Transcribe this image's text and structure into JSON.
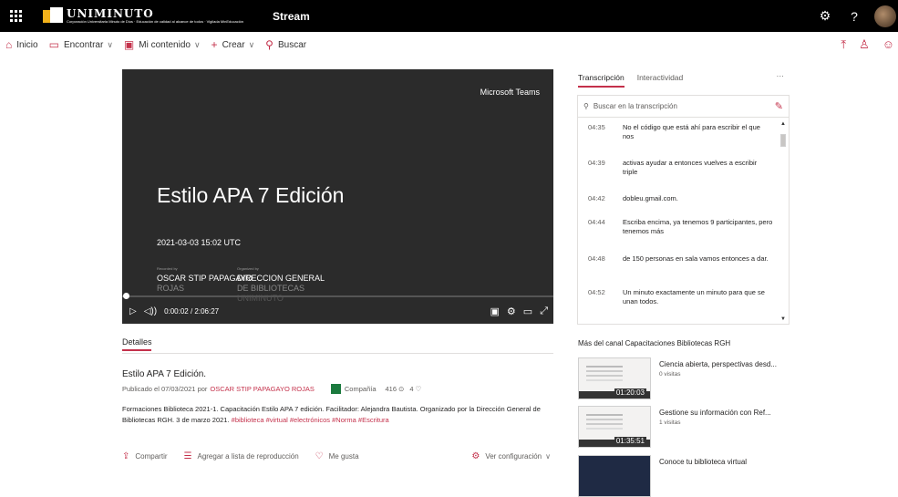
{
  "app": {
    "logo_name": "UNIMINUTO",
    "logo_sub": "Corporación Universitaria Minuto de Dios · Educación de calidad al alcance de todos · Vigilada MinEducación",
    "title": "Stream"
  },
  "nav": {
    "items": [
      {
        "label": "Inicio",
        "icon": "home-icon"
      },
      {
        "label": "Encontrar",
        "icon": "find-icon",
        "chevron": true
      },
      {
        "label": "Mi contenido",
        "icon": "content-icon",
        "chevron": true
      },
      {
        "label": "Crear",
        "icon": "plus-icon",
        "chevron": true
      },
      {
        "label": "Buscar",
        "icon": "search-icon"
      }
    ]
  },
  "video": {
    "brand": "Microsoft Teams",
    "title": "Estilo APA 7 Edición",
    "date": "2021-03-03 15:02 UTC",
    "recorded_label": "Recorded by",
    "recorded_by": "OSCAR STIP PAPAGAYO ROJAS",
    "recorded_line1": "OSCAR STIP PAPAGAYO",
    "recorded_line2": "ROJAS",
    "organized_label": "Organized by",
    "organized_line1": "DIRECCION GENERAL",
    "organized_line2": "DE BIBLIOTECAS",
    "organized_line3": "UNIMINUTO",
    "time": "0:00:02 / 2:06:27"
  },
  "details": {
    "tab": "Detalles",
    "title": "Estilo APA 7 Edición.",
    "published_prefix": "Publicado el 07/03/2021 por",
    "author": "OSCAR STIP PAPAGAYO ROJAS",
    "company": "Compañía",
    "views": "416",
    "likes": "4",
    "description": "Formaciones Biblioteca 2021-1. Capacitación Estilo APA 7 edición. Facilitador: Alejandra Bautista. Organizado por la Dirección General de Bibliotecas RGH. 3 de marzo 2021.",
    "tags": "#biblioteca #virtual #electrónicos #Norma #Escritura",
    "actions": {
      "share": "Compartir",
      "playlist": "Agregar a lista de reproducción",
      "like": "Me gusta",
      "settings": "Ver configuración"
    }
  },
  "panel": {
    "tab_transcript": "Transcripción",
    "tab_interactivity": "Interactividad",
    "more": "···",
    "search_placeholder": "Buscar en la transcripción",
    "rows": [
      {
        "time": "04:35",
        "text": "No el código que está ahí para escribir el que nos"
      },
      {
        "time": "04:39",
        "text": "activas ayudar a entonces vuelves a escribir triple"
      },
      {
        "time": "04:42",
        "text": "dobleu.gmail.com."
      },
      {
        "time": "04:44",
        "text": "Escriba encima, ya tenemos 9 participantes, pero tenemos más"
      },
      {
        "time": "04:48",
        "text": "de 150 personas en sala vamos entonces a dar."
      },
      {
        "time": "04:52",
        "text": "Un minuto exactamente un minuto para que se unan todos."
      }
    ]
  },
  "channel": {
    "title": "Más del canal Capacitaciones Bibliotecas RGH",
    "videos": [
      {
        "title": "Ciencia abierta, perspectivas desd...",
        "views": "0 visitas",
        "duration": "01:20:03"
      },
      {
        "title": "Gestione su información con Ref...",
        "views": "1 visitas",
        "duration": "01:35:51"
      },
      {
        "title": "Conoce tu biblioteca virtual",
        "views": "",
        "duration": ""
      }
    ]
  },
  "colors": {
    "accent": "#c4314b",
    "topbar": "#000000",
    "video_bg": "#2b2b2b"
  }
}
